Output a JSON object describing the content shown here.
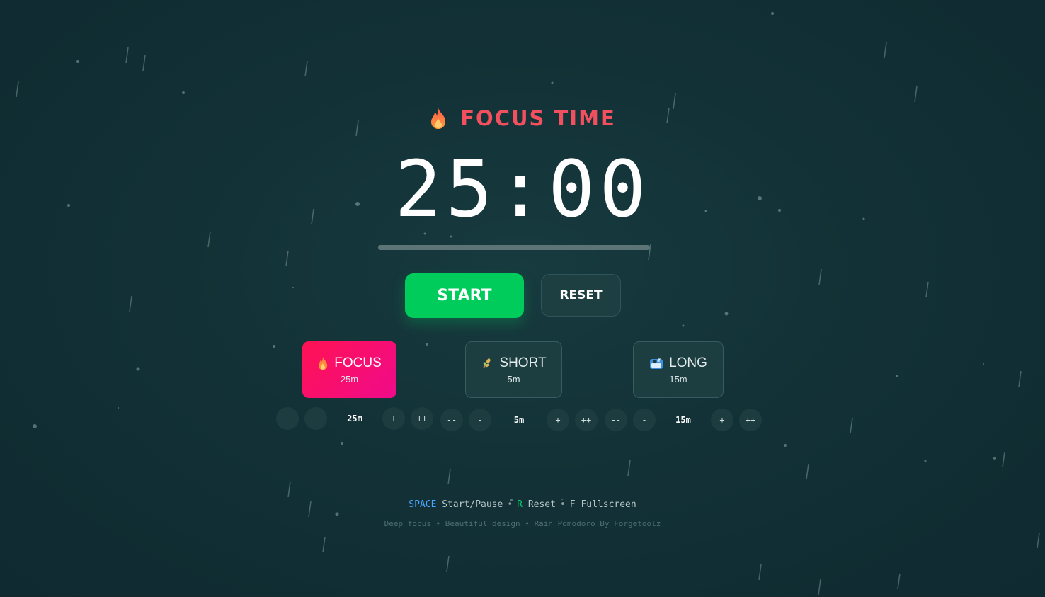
{
  "header": {
    "title": "FOCUS TIME",
    "icon": "flame-icon",
    "accent": "#f2505f"
  },
  "timer": {
    "display": "25:00",
    "progress": 0
  },
  "controls": {
    "start_label": "START",
    "reset_label": "RESET",
    "start_color": "#00cc5c"
  },
  "modes": [
    {
      "id": "focus",
      "label": "FOCUS",
      "duration": "25m",
      "icon": "flame-icon",
      "active": true
    },
    {
      "id": "short",
      "label": "SHORT",
      "duration": "5m",
      "icon": "leaf-icon",
      "active": false
    },
    {
      "id": "long",
      "label": "LONG",
      "duration": "15m",
      "icon": "sleep-icon",
      "active": false
    }
  ],
  "adjusters": [
    {
      "dec_big": "--",
      "dec": "-",
      "value": "25m",
      "inc": "+",
      "inc_big": "++"
    },
    {
      "dec_big": "--",
      "dec": "-",
      "value": "5m",
      "inc": "+",
      "inc_big": "++"
    },
    {
      "dec_big": "--",
      "dec": "-",
      "value": "15m",
      "inc": "+",
      "inc_big": "++"
    }
  ],
  "shortcuts": {
    "space_key": "SPACE",
    "space_action": "Start/Pause",
    "r_key": "R",
    "r_action": "Reset",
    "f_key": "F",
    "f_action": "Fullscreen",
    "separator": "•"
  },
  "footer": {
    "text": "Deep focus • Beautiful design • Rain Pomodoro By Forgetoolz"
  }
}
